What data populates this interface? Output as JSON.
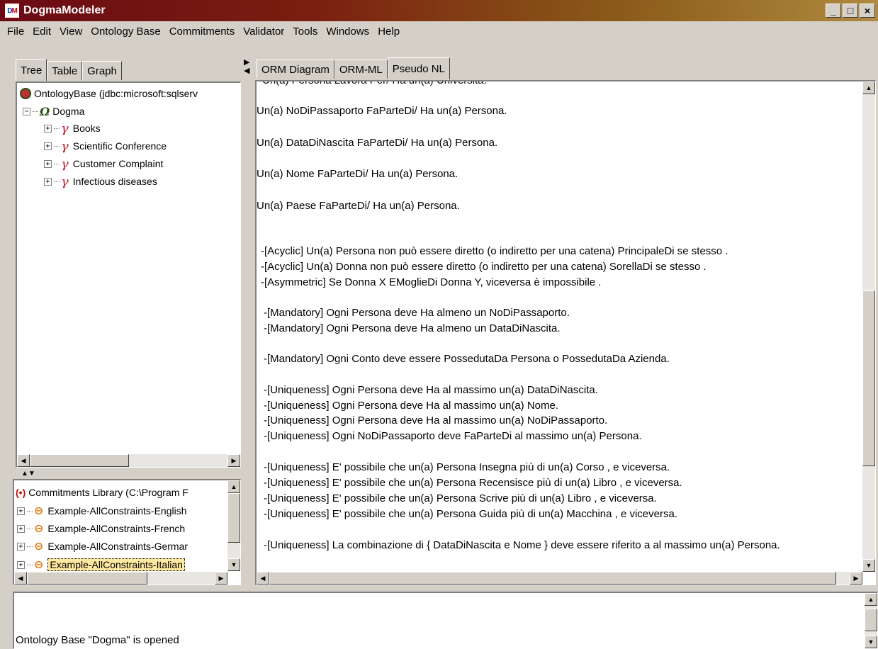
{
  "window": {
    "title": "DogmaModeler",
    "icon": "DM"
  },
  "menu": [
    "File",
    "Edit",
    "View",
    "Ontology Base",
    "Commitments",
    "Validator",
    "Tools",
    "Windows",
    "Help"
  ],
  "left_tabs": [
    "Tree",
    "Table",
    "Graph"
  ],
  "tree": {
    "root": "OntologyBase (jdbc:microsoft:sqlserv",
    "dogma": "Dogma",
    "children": [
      "Books",
      "Scientific Conference",
      "Customer Complaint",
      "Infectious diseases"
    ]
  },
  "commitments": {
    "header": "Commitments Library (C:\\Program F",
    "items": [
      "Example-AllConstraints-English",
      "Example-AllConstraints-French",
      "Example-AllConstraints-Germar",
      "Example-AllConstraints-Italian"
    ],
    "selected": "Example-AllConstraints-Italian"
  },
  "right_tabs": [
    "ORM Diagram",
    "ORM-ML",
    "Pseudo NL"
  ],
  "pseudo_nl": {
    "partial_top": "Un(a) Persona Lavora Per/ Ha un(a) Universita.",
    "lines": [
      "Un(a)  NoDiPassaporto FaParteDi/  Ha un(a)  Persona.",
      "Un(a)  DataDiNascita FaParteDi/  Ha un(a)  Persona.",
      "Un(a)  Nome FaParteDi/  Ha un(a)  Persona.",
      "Un(a)  Paese FaParteDi/  Ha un(a)  Persona.",
      " -[Acyclic] Un(a) Persona non può essere diretto (o indiretto per una catena)  PrincipaleDi se stesso .",
      " -[Acyclic] Un(a) Donna non può essere diretto (o indiretto per una catena)  SorellaDi se stesso .",
      " -[Asymmetric]  Se Donna X  EMoglieDi  Donna Y, viceversa è impossibile .",
      "  -[Mandatory]  Ogni Persona deve Ha almeno un NoDiPassaporto.",
      "  -[Mandatory]  Ogni Persona deve Ha almeno un DataDiNascita.",
      "  -[Mandatory]  Ogni Conto deve essere  PossedutaDa Persona o PossedutaDa Azienda.",
      "  -[Uniqueness]  Ogni Persona deve Ha al massimo un(a) DataDiNascita.",
      "  -[Uniqueness]  Ogni Persona deve Ha al massimo un(a) Nome.",
      "  -[Uniqueness]  Ogni Persona deve Ha al massimo un(a) NoDiPassaporto.",
      "  -[Uniqueness]  Ogni NoDiPassaporto deve FaParteDi al massimo un(a) Persona.",
      "  -[Uniqueness]  E' possibile che un(a) Persona Insegna  più di un(a)  Corso , e viceversa.",
      "  -[Uniqueness]  E' possibile che un(a) Persona Recensisce  più di un(a)  Libro , e viceversa.",
      "  -[Uniqueness]  E' possibile che un(a) Persona Scrive  più di un(a)  Libro  , e viceversa.",
      "  -[Uniqueness]  E' possibile che un(a) Persona Guida  più di un(a)  Macchina , e viceversa.",
      "  -[Uniqueness]  La combinazione di { DataDiNascita e Nome } deve essere riferito a al massimo un(a)  Persona."
    ]
  },
  "status": "Ontology Base \"Dogma\" is opened"
}
